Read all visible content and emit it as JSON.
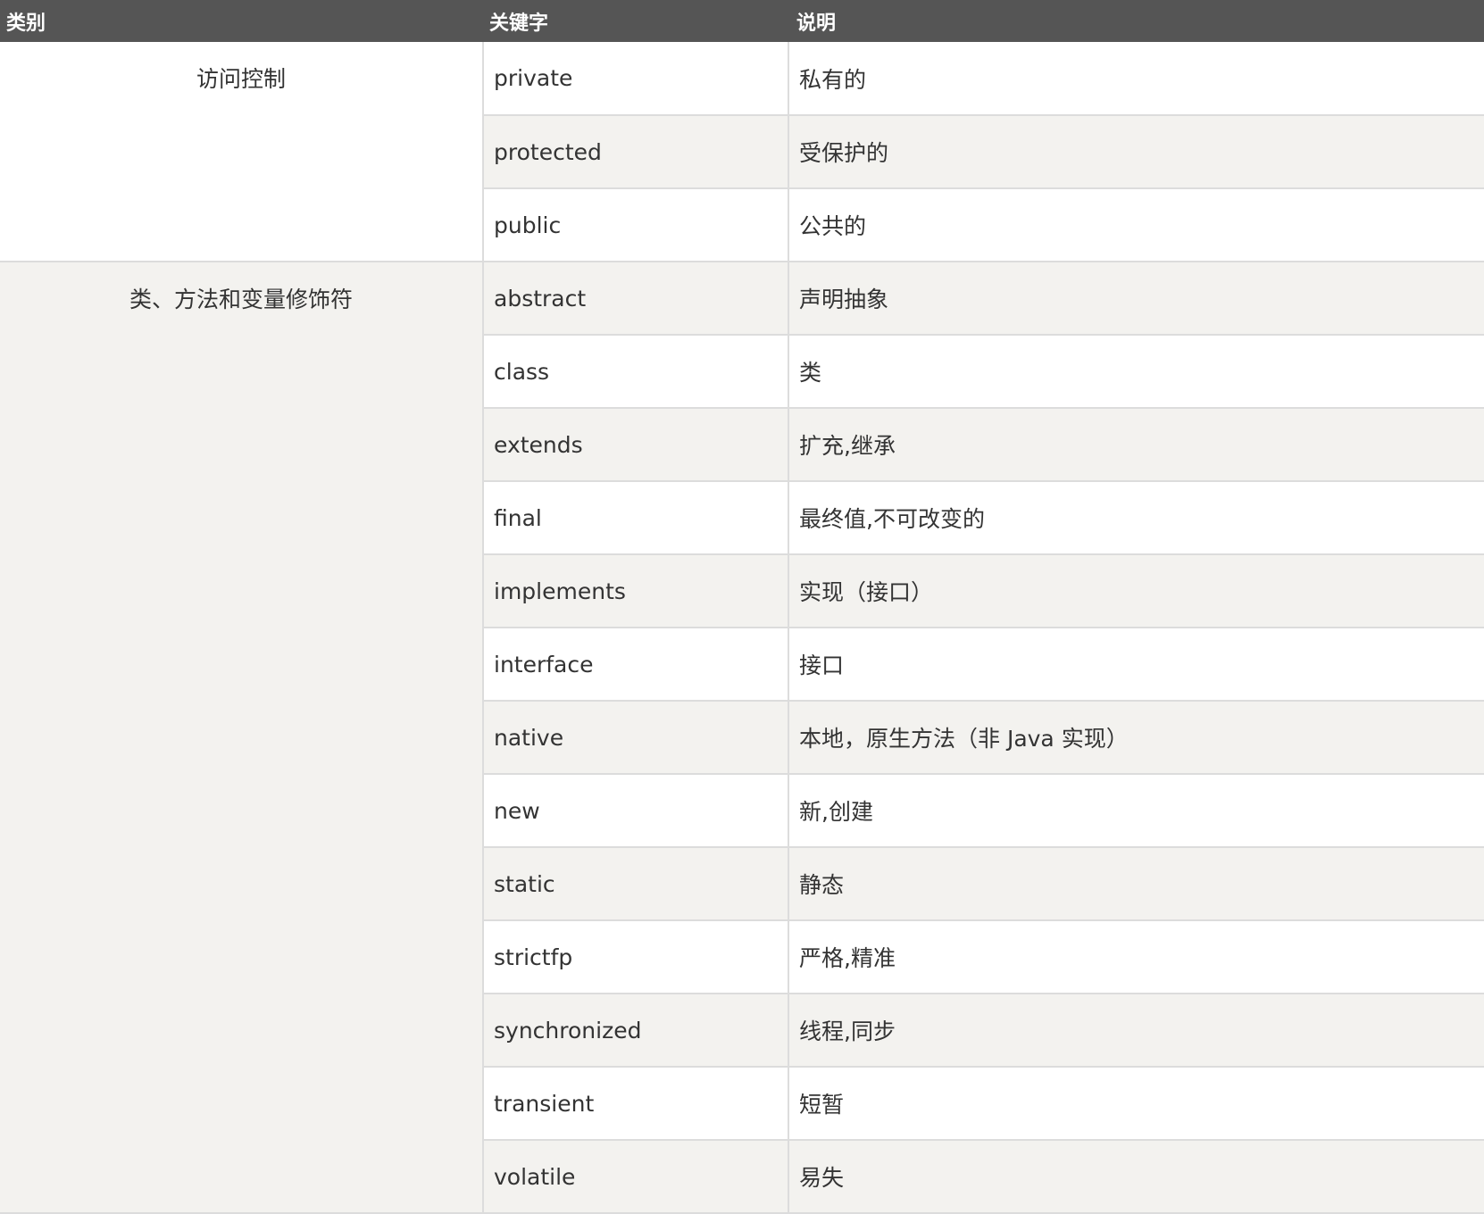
{
  "table": {
    "headers": [
      "类别",
      "关键字",
      "说明"
    ],
    "groups": [
      {
        "category": "访问控制",
        "rows": [
          {
            "keyword": "private",
            "description": "私有的"
          },
          {
            "keyword": "protected",
            "description": "受保护的"
          },
          {
            "keyword": "public",
            "description": "公共的"
          }
        ]
      },
      {
        "category": "类、方法和变量修饰符",
        "rows": [
          {
            "keyword": "abstract",
            "description": "声明抽象"
          },
          {
            "keyword": "class",
            "description": "类"
          },
          {
            "keyword": "extends",
            "description": "扩充,继承"
          },
          {
            "keyword": "final",
            "description": "最终值,不可改变的"
          },
          {
            "keyword": "implements",
            "description": "实现（接口）"
          },
          {
            "keyword": "interface",
            "description": "接口"
          },
          {
            "keyword": "native",
            "description": "本地，原生方法（非 Java 实现）"
          },
          {
            "keyword": "new",
            "description": "新,创建"
          },
          {
            "keyword": "static",
            "description": "静态"
          },
          {
            "keyword": "strictfp",
            "description": "严格,精准"
          },
          {
            "keyword": "synchronized",
            "description": "线程,同步"
          },
          {
            "keyword": "transient",
            "description": "短暂"
          },
          {
            "keyword": "volatile",
            "description": "易失"
          }
        ]
      }
    ]
  }
}
